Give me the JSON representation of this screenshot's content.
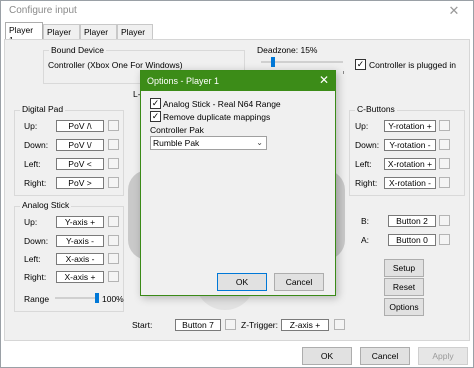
{
  "window": {
    "title": "Configure input",
    "close_glyph": "✕"
  },
  "tabs": [
    {
      "label": "Player 1",
      "active": true
    },
    {
      "label": "Player 2"
    },
    {
      "label": "Player 3"
    },
    {
      "label": "Player 4"
    }
  ],
  "bound_device": {
    "title": "Bound Device",
    "value": "Controller (Xbox One For Windows)"
  },
  "deadzone": {
    "label": "Deadzone: 15%",
    "value_percent": 15
  },
  "plugged_in": {
    "label": "Controller is plugged in",
    "checked": true
  },
  "ltrigger_label": "L-T",
  "digital_pad": {
    "title": "Digital Pad",
    "rows": [
      {
        "label": "Up:",
        "value": "PoV /\\"
      },
      {
        "label": "Down:",
        "value": "PoV \\/"
      },
      {
        "label": "Left:",
        "value": "PoV <"
      },
      {
        "label": "Right:",
        "value": "PoV >"
      }
    ]
  },
  "analog_stick": {
    "title": "Analog Stick",
    "rows": [
      {
        "label": "Up:",
        "value": "Y-axis +"
      },
      {
        "label": "Down:",
        "value": "Y-axis -"
      },
      {
        "label": "Left:",
        "value": "X-axis -"
      },
      {
        "label": "Right:",
        "value": "X-axis +"
      }
    ],
    "range_label": "Range",
    "range_value": "100%",
    "range_percent": 100
  },
  "c_buttons": {
    "title": "C-Buttons",
    "rows": [
      {
        "label": "Up:",
        "value": "Y-rotation +"
      },
      {
        "label": "Down:",
        "value": "Y-rotation -"
      },
      {
        "label": "Left:",
        "value": "X-rotation +"
      },
      {
        "label": "Right:",
        "value": "X-rotation -"
      }
    ]
  },
  "face_buttons": [
    {
      "label": "B:",
      "value": "Button 2"
    },
    {
      "label": "A:",
      "value": "Button 0"
    }
  ],
  "side_buttons": {
    "setup": "Setup",
    "reset": "Reset",
    "options": "Options"
  },
  "start": {
    "label": "Start:",
    "value": "Button 7"
  },
  "z_trigger": {
    "label": "Z-Trigger:",
    "value": "Z-axis +"
  },
  "footer": {
    "ok": "OK",
    "cancel": "Cancel",
    "apply": "Apply"
  },
  "options_dialog": {
    "title": "Options - Player 1",
    "close_glyph": "✕",
    "analog_real_n64": {
      "label": "Analog Stick - Real N64 Range",
      "checked": true
    },
    "remove_duplicates": {
      "label": "Remove duplicate mappings",
      "checked": true
    },
    "pak_label": "Controller Pak",
    "pak_value": "Rumble Pak",
    "ok": "OK",
    "cancel": "Cancel",
    "check_glyph": "✓",
    "dropdown_glyph": "⌄"
  },
  "colors": {
    "accent": "#3c8c18",
    "slider": "#0078d7"
  }
}
